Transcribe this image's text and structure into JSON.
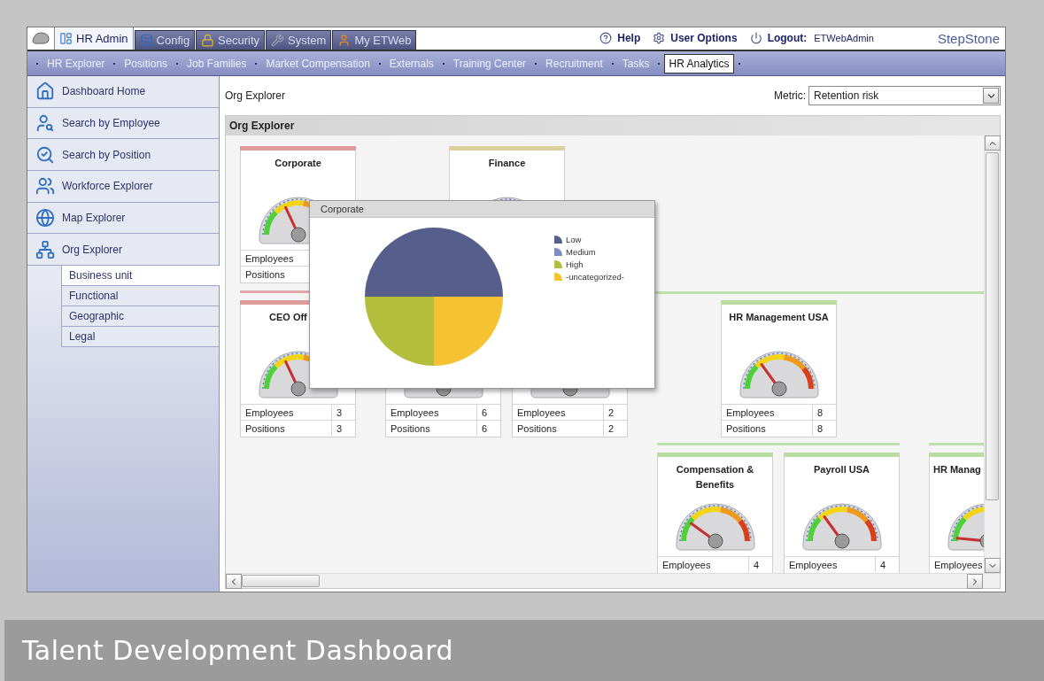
{
  "tabs": [
    {
      "label": "HR Admin",
      "kind": "admin",
      "selected": true
    },
    {
      "label": "Config",
      "kind": "config",
      "selected": false
    },
    {
      "label": "Security",
      "kind": "security",
      "selected": false
    },
    {
      "label": "System",
      "kind": "system",
      "selected": false
    },
    {
      "label": "My ETWeb",
      "kind": "person",
      "selected": false
    }
  ],
  "header_links": [
    {
      "label": "Help",
      "kind": "help"
    },
    {
      "label": "User Options",
      "kind": "options"
    },
    {
      "label": "Logout:",
      "kind": "logout"
    }
  ],
  "user": "ETWebAdmin",
  "logo": "StepStone",
  "nav": [
    {
      "label": "HR Explorer",
      "selected": false
    },
    {
      "label": "Positions",
      "selected": false
    },
    {
      "label": "Job Families",
      "selected": false
    },
    {
      "label": "Market Compensation",
      "selected": false
    },
    {
      "label": "Externals",
      "selected": false
    },
    {
      "label": "Training Center",
      "selected": false
    },
    {
      "label": "Recruitment",
      "selected": false
    },
    {
      "label": "Tasks",
      "selected": false
    },
    {
      "label": "HR Analytics",
      "selected": true
    }
  ],
  "sidebar": {
    "items": [
      {
        "label": "Dashboard Home",
        "kind": "home"
      },
      {
        "label": "Search by Employee",
        "kind": "employee"
      },
      {
        "label": "Search by Position",
        "kind": "position"
      },
      {
        "label": "Workforce Explorer",
        "kind": "workforce"
      },
      {
        "label": "Map Explorer",
        "kind": "map"
      },
      {
        "label": "Org Explorer",
        "kind": "org",
        "children": [
          {
            "label": "Business unit",
            "selected": true
          },
          {
            "label": "Functional",
            "selected": false
          },
          {
            "label": "Geographic",
            "selected": false
          },
          {
            "label": "Legal",
            "selected": false
          }
        ]
      }
    ]
  },
  "main": {
    "title": "Org Explorer",
    "metric": {
      "label": "Metric:",
      "value": "Retention risk"
    },
    "panel_title": "Org Explorer",
    "nodes": [
      {
        "title": "Corporate",
        "color": "#e09c9c",
        "level": 0.36,
        "rows": [
          {
            "label": "Employees"
          },
          {
            "label": "Positions"
          }
        ]
      },
      {
        "title": "Finance",
        "color": "#dbd09e"
      },
      {
        "title": "CEO Off",
        "color": "#e09c9c",
        "level": 0.36,
        "rows": [
          {
            "label": "Employees",
            "value": "3"
          },
          {
            "label": "Positions",
            "value": "3"
          }
        ]
      },
      {
        "rows": [
          {
            "label": "Employees",
            "value": "6"
          },
          {
            "label": "Positions",
            "value": "6"
          }
        ]
      },
      {
        "rows": [
          {
            "label": "Employees",
            "value": "2"
          },
          {
            "label": "Positions",
            "value": "2"
          }
        ]
      },
      {
        "title": "HR Management USA",
        "color": "#b9dca0",
        "level": 0.3,
        "rows": [
          {
            "label": "Employees",
            "value": "8"
          },
          {
            "label": "Positions",
            "value": "8"
          }
        ]
      },
      {
        "title": "Compensation & Benefits",
        "color": "#b9dca0",
        "level": 0.2,
        "rows": [
          {
            "label": "Employees",
            "value": "4"
          }
        ]
      },
      {
        "title": "Payroll USA",
        "color": "#b9dca0",
        "level": 0.3,
        "rows": [
          {
            "label": "Employees",
            "value": "4"
          }
        ]
      },
      {
        "title": "HR Manag",
        "color": "#b9dca0",
        "level": 0.03,
        "rows": [
          {
            "label": "Employees"
          }
        ]
      }
    ],
    "popup": {
      "title": "Corporate",
      "legend": [
        {
          "label": "Low",
          "color": "#565e8c"
        },
        {
          "label": "Medium",
          "color": "#7c8cc4"
        },
        {
          "label": "High",
          "color": "#b3bf3c"
        },
        {
          "label": "-uncategorized-",
          "color": "#f5c233"
        }
      ]
    }
  },
  "banner": "Talent Development Dashboard"
}
